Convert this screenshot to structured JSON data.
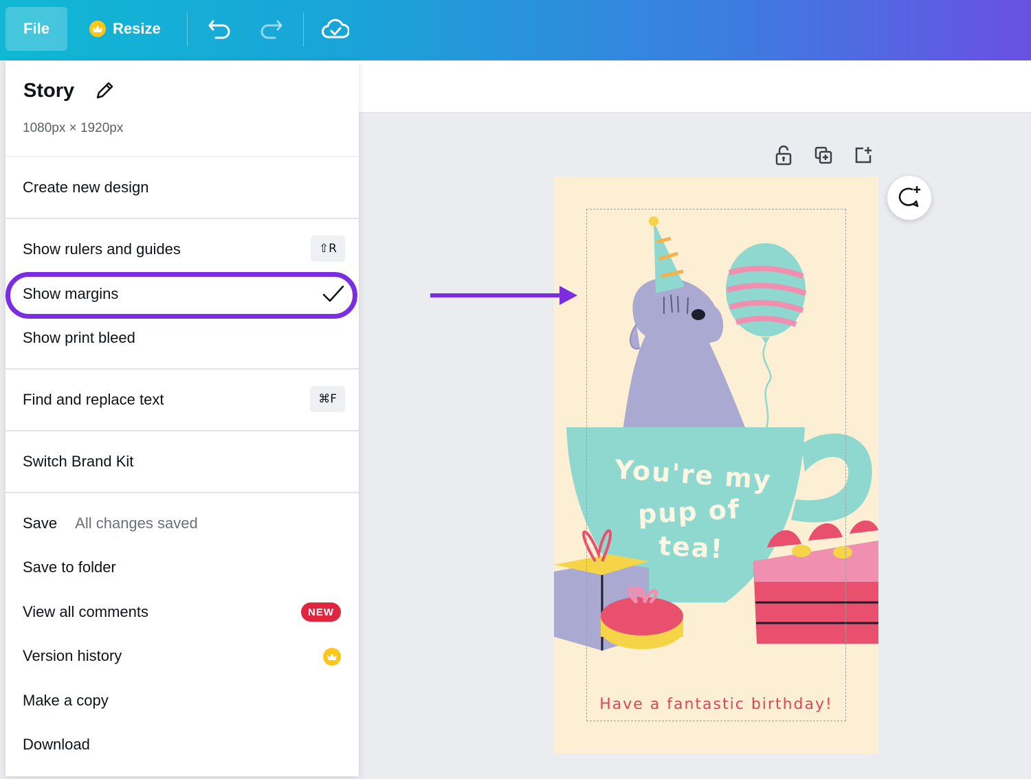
{
  "topbar": {
    "file_label": "File",
    "resize_label": "Resize",
    "icons": [
      "undo-icon",
      "redo-icon",
      "cloud-saved-icon"
    ]
  },
  "menu": {
    "title": "Story",
    "dimensions": "1080px × 1920px",
    "items": {
      "create_new_design": "Create new design",
      "show_rulers": "Show rulers and guides",
      "show_rulers_shortcut": "⇧R",
      "show_margins": "Show margins",
      "show_margins_checked": true,
      "show_print_bleed": "Show print bleed",
      "find_replace": "Find and replace text",
      "find_replace_shortcut": "⌘F",
      "switch_brand_kit": "Switch Brand Kit",
      "save": "Save",
      "save_status": "All changes saved",
      "save_to_folder": "Save to folder",
      "view_comments": "View all comments",
      "view_comments_badge": "NEW",
      "version_history": "Version history",
      "make_copy": "Make a copy",
      "download": "Download"
    }
  },
  "design": {
    "line1": "You're my",
    "line2": "pup of",
    "line3": "tea!",
    "footer": "Have a fantastic birthday!",
    "background_color": "#fcefd3"
  },
  "colors": {
    "accent_purple": "#7a2ee0",
    "badge_red": "#e0263e",
    "crown_gold": "#ffc61a"
  }
}
